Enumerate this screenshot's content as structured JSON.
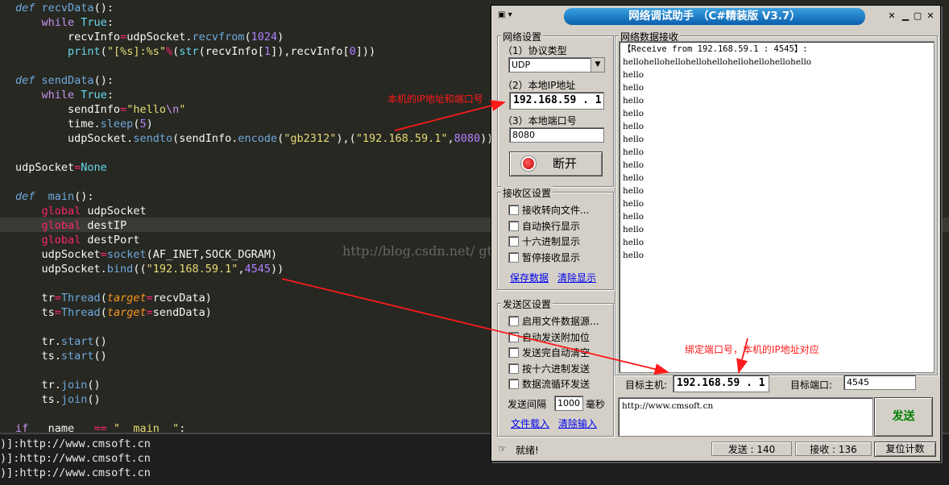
{
  "editor": {
    "lines": [
      {
        "tokens": [
          [
            "kw",
            "def"
          ],
          [
            "plain",
            " "
          ],
          [
            "fn",
            "recvData"
          ],
          [
            "plain",
            "():"
          ]
        ]
      },
      {
        "tokens": [
          [
            "plain",
            "    "
          ],
          [
            "ctl",
            "while"
          ],
          [
            "plain",
            " "
          ],
          [
            "bi",
            "True"
          ],
          [
            "plain",
            ":"
          ]
        ]
      },
      {
        "tokens": [
          [
            "plain",
            "        recvInfo"
          ],
          [
            "op",
            "="
          ],
          [
            "plain",
            "udpSocket."
          ],
          [
            "fn",
            "recvfrom"
          ],
          [
            "plain",
            "("
          ],
          [
            "num",
            "1024"
          ],
          [
            "plain",
            ")"
          ]
        ]
      },
      {
        "tokens": [
          [
            "plain",
            "        "
          ],
          [
            "bi",
            "print"
          ],
          [
            "plain",
            "("
          ],
          [
            "str",
            "\"[%s]:%s\""
          ],
          [
            "op",
            "%"
          ],
          [
            "plain",
            "("
          ],
          [
            "bi",
            "str"
          ],
          [
            "plain",
            "(recvInfo["
          ],
          [
            "num",
            "1"
          ],
          [
            "plain",
            "]),recvInfo["
          ],
          [
            "num",
            "0"
          ],
          [
            "plain",
            "]))"
          ]
        ]
      },
      {
        "tokens": []
      },
      {
        "tokens": [
          [
            "kw",
            "def"
          ],
          [
            "plain",
            " "
          ],
          [
            "fn",
            "sendData"
          ],
          [
            "plain",
            "():"
          ]
        ]
      },
      {
        "tokens": [
          [
            "plain",
            "    "
          ],
          [
            "ctl",
            "while"
          ],
          [
            "plain",
            " "
          ],
          [
            "bi",
            "True"
          ],
          [
            "plain",
            ":"
          ]
        ]
      },
      {
        "tokens": [
          [
            "plain",
            "        sendInfo"
          ],
          [
            "op",
            "="
          ],
          [
            "str",
            "\"hello"
          ],
          [
            "ctl",
            "\\n"
          ],
          [
            "str",
            "\""
          ]
        ]
      },
      {
        "tokens": [
          [
            "plain",
            "        time."
          ],
          [
            "fn",
            "sleep"
          ],
          [
            "plain",
            "("
          ],
          [
            "num",
            "5"
          ],
          [
            "plain",
            ")"
          ]
        ]
      },
      {
        "tokens": [
          [
            "plain",
            "        udpSocket."
          ],
          [
            "fn",
            "sendto"
          ],
          [
            "plain",
            "(sendInfo."
          ],
          [
            "fn",
            "encode"
          ],
          [
            "plain",
            "("
          ],
          [
            "str",
            "\"gb2312\""
          ],
          [
            "plain",
            "),("
          ],
          [
            "str",
            "\"192.168.59.1\""
          ],
          [
            "plain",
            ","
          ],
          [
            "num",
            "8080"
          ],
          [
            "plain",
            "))"
          ]
        ]
      },
      {
        "tokens": []
      },
      {
        "tokens": [
          [
            "plain",
            "udpSocket"
          ],
          [
            "op",
            "="
          ],
          [
            "bi",
            "None"
          ]
        ]
      },
      {
        "tokens": []
      },
      {
        "tokens": [
          [
            "kw",
            "def"
          ],
          [
            "plain",
            "  "
          ],
          [
            "fn",
            "main"
          ],
          [
            "plain",
            "():"
          ]
        ]
      },
      {
        "tokens": [
          [
            "plain",
            "    "
          ],
          [
            "gl",
            "global"
          ],
          [
            "plain",
            " udpSocket"
          ]
        ]
      },
      {
        "tokens": [
          [
            "plain",
            "    "
          ],
          [
            "gl",
            "global"
          ],
          [
            "plain",
            " destIP"
          ]
        ]
      },
      {
        "tokens": [
          [
            "plain",
            "    "
          ],
          [
            "gl",
            "global"
          ],
          [
            "plain",
            " destPort"
          ]
        ]
      },
      {
        "tokens": [
          [
            "plain",
            "    udpSocket"
          ],
          [
            "op",
            "="
          ],
          [
            "fn",
            "socket"
          ],
          [
            "plain",
            "(AF_INET,SOCK_DGRAM)"
          ]
        ]
      },
      {
        "tokens": [
          [
            "plain",
            "    udpSocket."
          ],
          [
            "fn",
            "bind"
          ],
          [
            "plain",
            "(("
          ],
          [
            "str",
            "\"192.168.59.1\""
          ],
          [
            "plain",
            ","
          ],
          [
            "num",
            "4545"
          ],
          [
            "plain",
            "))"
          ]
        ]
      },
      {
        "tokens": []
      },
      {
        "tokens": [
          [
            "plain",
            "    tr"
          ],
          [
            "op",
            "="
          ],
          [
            "fn",
            "Thread"
          ],
          [
            "plain",
            "("
          ],
          [
            "param",
            "target"
          ],
          [
            "op",
            "="
          ],
          [
            "plain",
            "recvData)"
          ]
        ]
      },
      {
        "tokens": [
          [
            "plain",
            "    ts"
          ],
          [
            "op",
            "="
          ],
          [
            "fn",
            "Thread"
          ],
          [
            "plain",
            "("
          ],
          [
            "param",
            "target"
          ],
          [
            "op",
            "="
          ],
          [
            "plain",
            "sendData)"
          ]
        ]
      },
      {
        "tokens": []
      },
      {
        "tokens": [
          [
            "plain",
            "    tr."
          ],
          [
            "fn",
            "start"
          ],
          [
            "plain",
            "()"
          ]
        ]
      },
      {
        "tokens": [
          [
            "plain",
            "    ts."
          ],
          [
            "fn",
            "start"
          ],
          [
            "plain",
            "()"
          ]
        ]
      },
      {
        "tokens": []
      },
      {
        "tokens": [
          [
            "plain",
            "    tr."
          ],
          [
            "fn",
            "join"
          ],
          [
            "plain",
            "()"
          ]
        ]
      },
      {
        "tokens": [
          [
            "plain",
            "    ts."
          ],
          [
            "fn",
            "join"
          ],
          [
            "plain",
            "()"
          ]
        ]
      },
      {
        "tokens": []
      },
      {
        "tokens": [
          [
            "ctl",
            "if"
          ],
          [
            "plain",
            " __name__ "
          ],
          [
            "op",
            "=="
          ],
          [
            "plain",
            " "
          ],
          [
            "str",
            "\"__main__\""
          ],
          [
            "plain",
            ":"
          ]
        ]
      }
    ],
    "watermark": "http://blog.csdn.net/           gtan"
  },
  "console": {
    "lines": [
      ")]:http://www.cmsoft.cn",
      ")]:http://www.cmsoft.cn",
      ")]:http://www.cmsoft.cn"
    ]
  },
  "tool": {
    "title": "网络调试助手 （C#精装版 V3.7）",
    "net_settings": {
      "label": "网络设置",
      "protocol_label": "（1）协议类型",
      "protocol_value": "UDP",
      "local_ip_label": "（2）本地IP地址",
      "local_ip_value": "192.168.59 . 1",
      "local_port_label": "（3）本地端口号",
      "local_port_value": "8080",
      "disconnect_label": "断开"
    },
    "recv_settings": {
      "label": "接收区设置",
      "options": [
        "接收转向文件...",
        "自动换行显示",
        "十六进制显示",
        "暂停接收显示"
      ],
      "save_link": "保存数据",
      "clear_link": "清除显示"
    },
    "send_settings": {
      "label": "发送区设置",
      "options": [
        "启用文件数据源...",
        "自动发送附加位",
        "发送完自动清空",
        "按十六进制发送",
        "数据流循环发送"
      ],
      "interval_label": "发送间隔",
      "interval_value": "1000",
      "interval_unit": "毫秒",
      "load_link": "文件载入",
      "clear_input_link": "清除输入"
    },
    "recv_panel": {
      "label": "网络数据接收",
      "header": "【Receive from 192.168.59.1 : 4545】:",
      "first_line": "hellohellohellohellohellohellohellohellohello",
      "repeat_line": "hello",
      "repeat_count": 15
    },
    "target": {
      "host_label": "目标主机:",
      "host_value": "192.168.59 . 1",
      "port_label": "目标端口:",
      "port_value": "4545"
    },
    "send_box": {
      "value": "http://www.cmsoft.cn",
      "send_label": "发送"
    },
    "status": {
      "ready": "就绪!",
      "sent": "发送 : 140",
      "received": "接收 : 136",
      "reset": "复位计数"
    }
  },
  "annotations": {
    "local_ip_note": "本机的IP地址和端口号",
    "bind_note": "绑定端口号，本机的IP地址对应"
  },
  "colors": {
    "editor_bg": "#272822",
    "annotation": "#ff1a1a",
    "title_pill": "#0a5fae",
    "send_button_text": "#008000"
  }
}
